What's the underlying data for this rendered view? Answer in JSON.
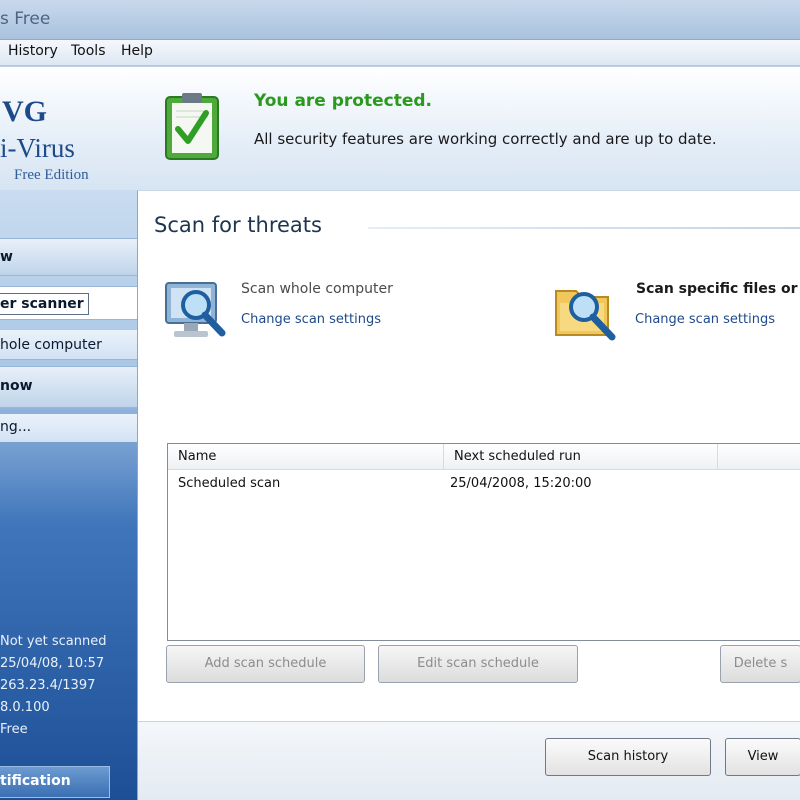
{
  "window": {
    "title": "s Free"
  },
  "menu": {
    "items": [
      "History",
      "Tools",
      "Help"
    ]
  },
  "logo": {
    "line1": "VG",
    "line2": "i-Virus",
    "line3": "Free Edition"
  },
  "status": {
    "title": "You are protected.",
    "description": "All security features are working correctly and are up to date."
  },
  "sidebar": {
    "item1": "w",
    "item2": "er scanner",
    "item3": "hole computer",
    "item4": "now",
    "item5": "ng...",
    "info": [
      "Not yet scanned",
      "25/04/08, 10:57",
      "263.23.4/1397",
      "8.0.100",
      "Free"
    ],
    "notification": "tification"
  },
  "main": {
    "title": "Scan for threats",
    "scan_whole": {
      "title": "Scan whole computer",
      "link": "Change scan settings"
    },
    "scan_specific": {
      "title": "Scan specific files or",
      "link": "Change scan settings"
    },
    "table": {
      "headers": [
        "Name",
        "Next scheduled run"
      ],
      "rows": [
        {
          "name": "Scheduled scan",
          "next": "25/04/2008, 15:20:00"
        }
      ]
    },
    "buttons": {
      "add": "Add scan schedule",
      "edit": "Edit scan schedule",
      "delete": "Delete s",
      "history": "Scan history",
      "view": "View"
    }
  },
  "colors": {
    "protected_green": "#2a9a1f",
    "brand_blue": "#1d4b8a"
  }
}
